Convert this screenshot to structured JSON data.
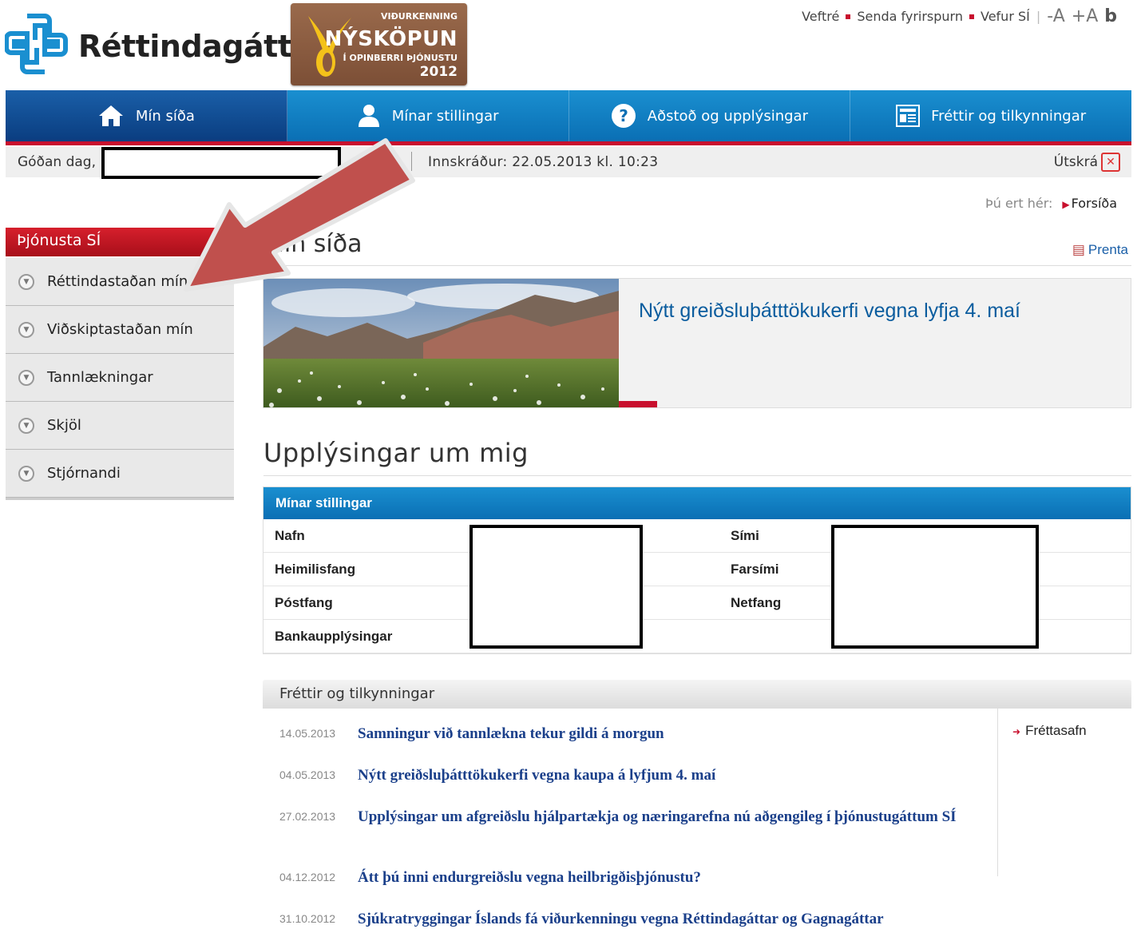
{
  "header": {
    "logo_text": "Réttindagátt",
    "award": {
      "line1": "VIÐURKENNING",
      "line2": "NÝSKÖPUN",
      "line3": "Í OPINBERRI ÞJÓNUSTU",
      "line4": "2012"
    },
    "top_links": {
      "sitemap": "Veftré",
      "send_query": "Senda fyrirspurn",
      "website": "Vefur SÍ",
      "decrease_font": "-A",
      "increase_font": "+A",
      "contrast": "b"
    }
  },
  "nav": {
    "items": [
      {
        "label": "Mín síða",
        "icon": "home-icon"
      },
      {
        "label": "Mínar stillingar",
        "icon": "user-icon"
      },
      {
        "label": "Aðstoð og upplýsingar",
        "icon": "help-icon"
      },
      {
        "label": "Fréttir og tilkynningar",
        "icon": "news-icon"
      }
    ]
  },
  "greeting": {
    "label": "Góðan dag,",
    "login_time": "Innskráður: 22.05.2013 kl. 10:23",
    "logout": "Útskrá"
  },
  "breadcrumb": {
    "prefix": "Þú ert hér:",
    "current": "Forsíða"
  },
  "sidebar": {
    "title": "Þjónusta SÍ",
    "items": [
      {
        "label": "Réttindastaðan mín"
      },
      {
        "label": "Viðskiptastaðan mín"
      },
      {
        "label": "Tannlækningar"
      },
      {
        "label": "Skjöl"
      },
      {
        "label": "Stjórnandi"
      }
    ]
  },
  "main": {
    "page_title": "Mín síða",
    "print_label": "Prenta",
    "banner_headline": "Nýtt greiðsluþátttökukerfi vegna lyfja 4. maí",
    "info_title": "Upplýsingar um mig",
    "info_table": {
      "header": "Mínar stillingar",
      "rows": [
        {
          "left": "Nafn",
          "right": "Sími"
        },
        {
          "left": "Heimilisfang",
          "right": "Farsími"
        },
        {
          "left": "Póstfang",
          "right": "Netfang"
        },
        {
          "left": "Bankaupplýsingar",
          "right": ""
        }
      ]
    },
    "news": {
      "title": "Fréttir og tilkynningar",
      "archive": "Fréttasafn",
      "items": [
        {
          "date": "14.05.2013",
          "title": "Samningur við tannlækna tekur gildi á morgun"
        },
        {
          "date": "04.05.2013",
          "title": "Nýtt greiðsluþátttökukerfi vegna kaupa á lyfjum 4. maí"
        },
        {
          "date": "27.02.2013",
          "title": "Upplýsingar um afgreiðslu hjálpartækja og næringarefna nú aðgengileg í þjónustugáttum SÍ"
        },
        {
          "date": "04.12.2012",
          "title": "Átt þú inni endurgreiðslu vegna heilbrigðisþjónustu?"
        },
        {
          "date": "31.10.2012",
          "title": "Sjúkratryggingar Íslands fá viðurkenningu vegna Réttindagáttar og Gagnagáttar"
        }
      ]
    }
  },
  "colors": {
    "brand_blue": "#0a6fb4",
    "brand_red": "#c8102e",
    "link_blue": "#1a3f8a"
  }
}
